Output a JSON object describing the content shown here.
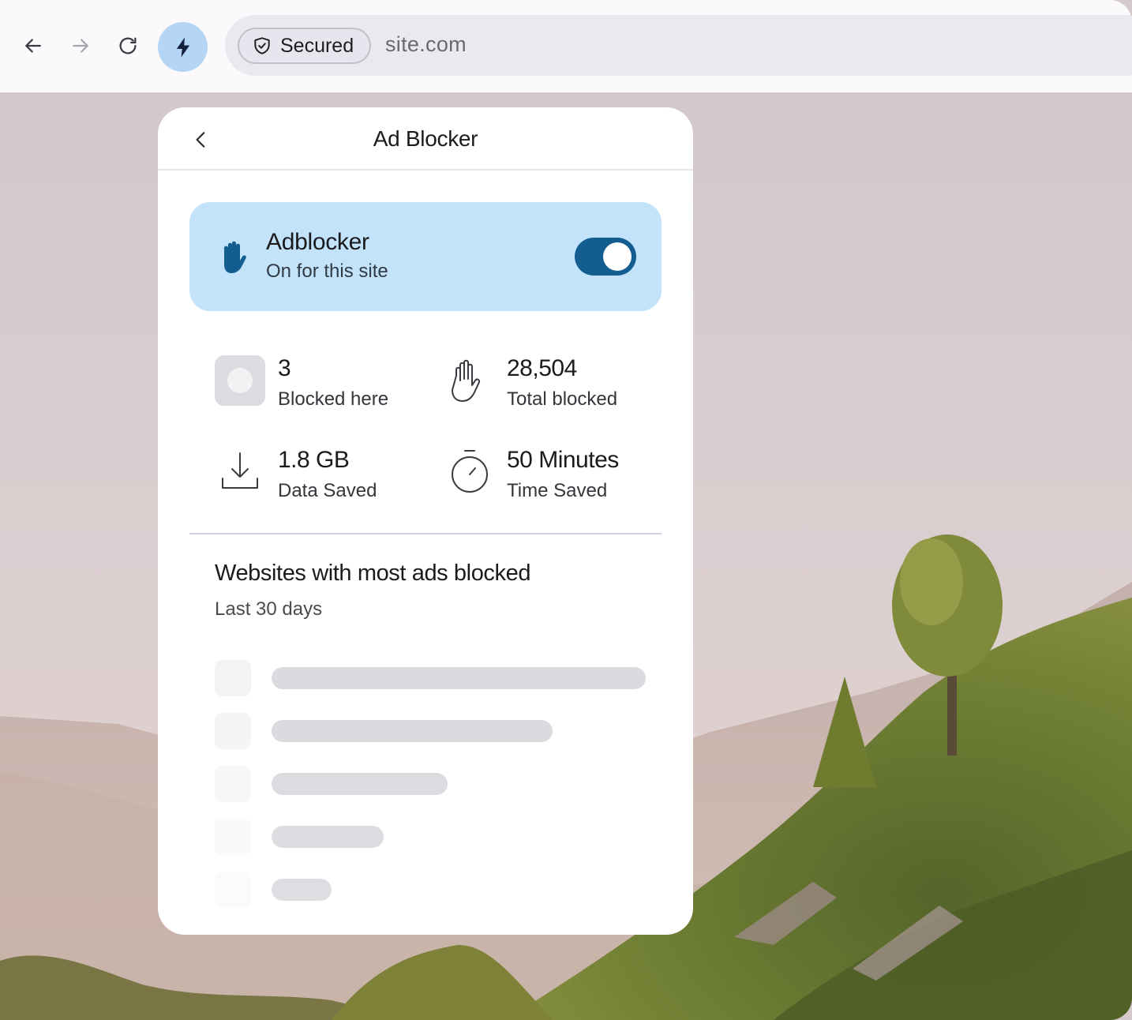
{
  "toolbar": {
    "security_label": "Secured",
    "url": "site.com"
  },
  "panel": {
    "title": "Ad Blocker",
    "adblocker": {
      "title": "Adblocker",
      "status": "On for this site",
      "enabled": true
    },
    "stats": [
      {
        "value": "3",
        "label": "Blocked here",
        "icon": "favicon-placeholder-icon"
      },
      {
        "value": "28,504",
        "label": "Total blocked",
        "icon": "hand-stop-icon"
      },
      {
        "value": "1.8 GB",
        "label": "Data Saved",
        "icon": "download-icon"
      },
      {
        "value": "50 Minutes",
        "label": "Time Saved",
        "icon": "stopwatch-icon"
      }
    ],
    "section": {
      "title": "Websites with most ads blocked",
      "subtitle": "Last 30 days"
    },
    "placeholder_rows": [
      1.0,
      0.75,
      0.47,
      0.3,
      0.16
    ]
  },
  "colors": {
    "accent": "#145d91",
    "card_bg": "#c3e3fb",
    "bolt_bg": "#b4d5f3"
  }
}
